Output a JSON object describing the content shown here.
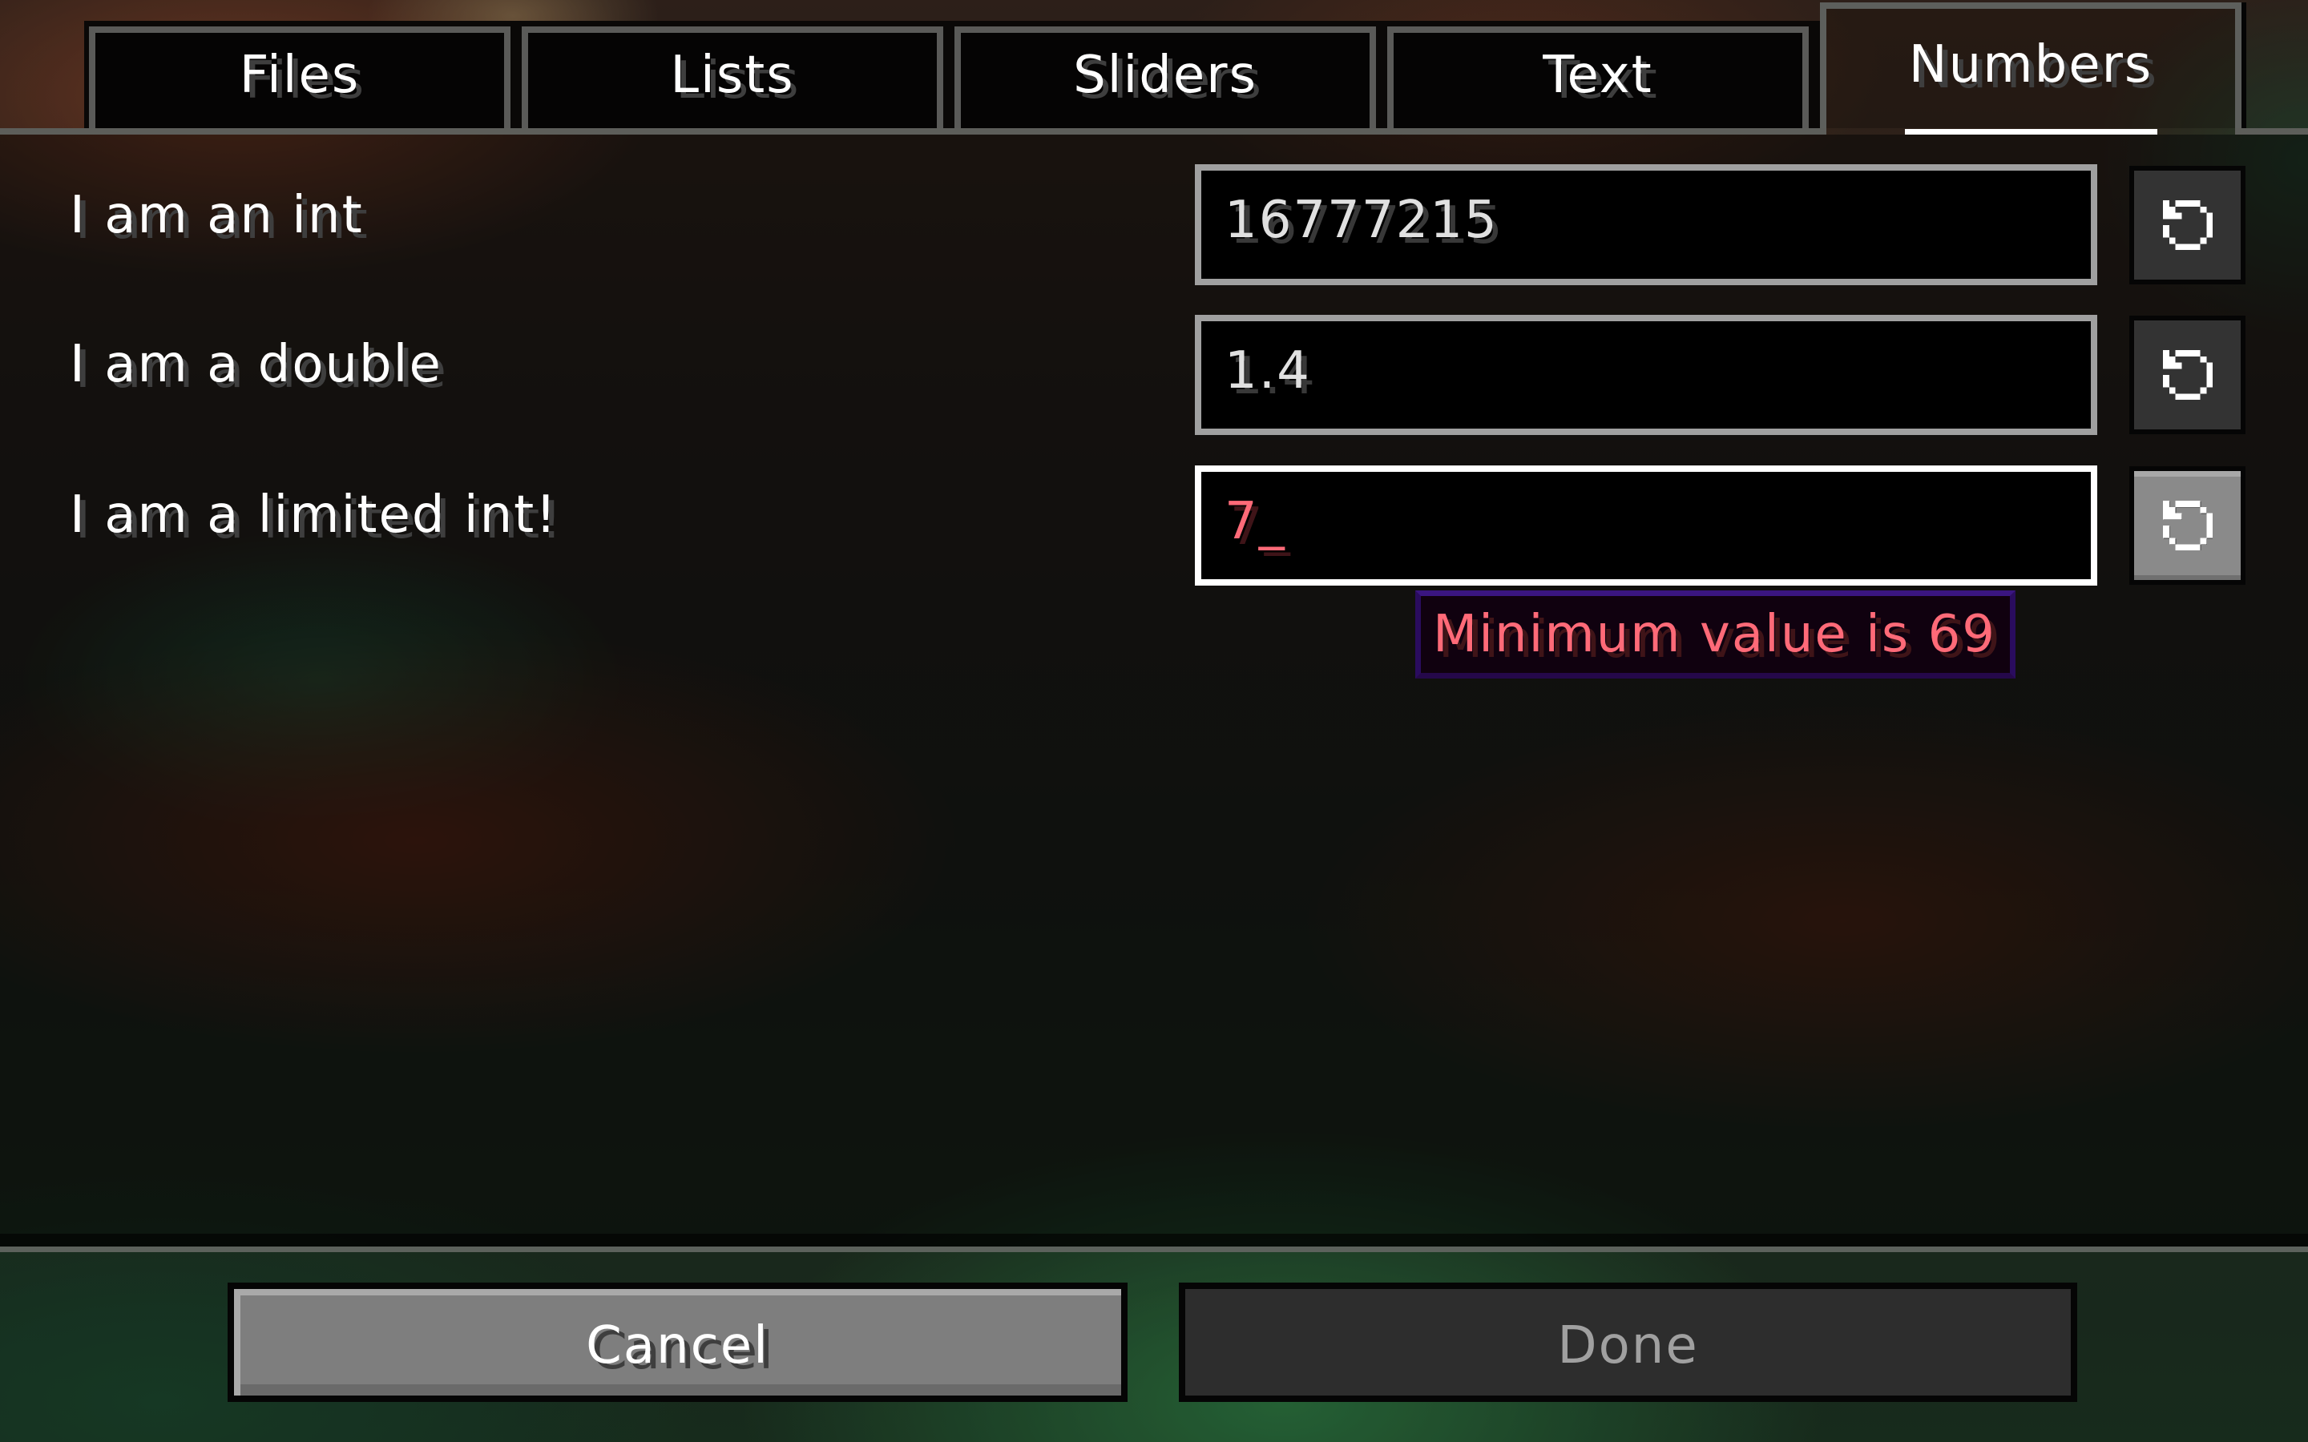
{
  "tabs": [
    {
      "label": "Files",
      "selected": false
    },
    {
      "label": "Lists",
      "selected": false
    },
    {
      "label": "Sliders",
      "selected": false
    },
    {
      "label": "Text",
      "selected": false
    },
    {
      "label": "Numbers",
      "selected": true
    }
  ],
  "settings": [
    {
      "label": "I am an int",
      "value": "16777215",
      "focused": false,
      "error": false,
      "reset_icon": "reset-icon"
    },
    {
      "label": "I am a double",
      "value": "1.4",
      "focused": false,
      "error": false,
      "reset_icon": "reset-icon"
    },
    {
      "label": "I am a limited int!",
      "value": "7_",
      "focused": true,
      "error": true,
      "reset_icon": "reset-icon"
    }
  ],
  "tooltip": {
    "text": "Minimum value is 69"
  },
  "footer": {
    "cancel_label": "Cancel",
    "done_label": "Done",
    "done_enabled": false
  },
  "colors": {
    "error_text": "#ff6a78",
    "tooltip_border": "#2a0c5e",
    "field_border": "#a0a0a0",
    "field_border_focused": "#ffffff"
  }
}
